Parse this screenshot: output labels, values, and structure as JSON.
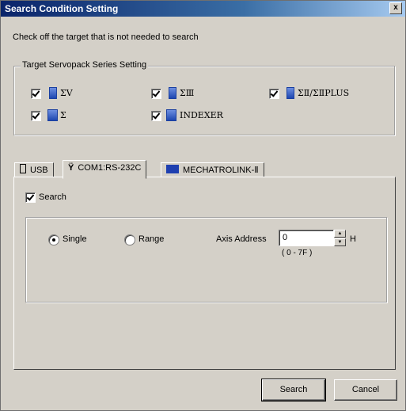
{
  "window": {
    "title": "Search Condition Setting",
    "close_label": "x"
  },
  "instruction": "Check off the target that is not needed to search",
  "target_group": {
    "label": "Target Servopack Series Setting",
    "items": [
      {
        "label": "ΣV",
        "checked": true
      },
      {
        "label": "ΣⅢ",
        "checked": true
      },
      {
        "label": "ΣⅡ/ΣⅡPLUS",
        "checked": true
      },
      {
        "label": "Σ",
        "checked": true
      },
      {
        "label": "INDEXER",
        "checked": true
      }
    ]
  },
  "tabs": [
    {
      "label": "USB",
      "active": false
    },
    {
      "label": "COM1:RS-232C",
      "active": true
    },
    {
      "label": "MECHATROLINK-Ⅱ",
      "active": false
    }
  ],
  "panel": {
    "search_label": "Search",
    "search_checked": true,
    "single_label": "Single",
    "range_label": "Range",
    "selected_mode": "Single",
    "axis_address_label": "Axis Address",
    "axis_address_value": "0",
    "unit": "H",
    "range_hint": "( 0 - 7F )"
  },
  "buttons": {
    "search": "Search",
    "cancel": "Cancel"
  },
  "colors": {
    "title_start": "#0a246a",
    "title_end": "#a6caf0",
    "face": "#d4d0c8"
  }
}
